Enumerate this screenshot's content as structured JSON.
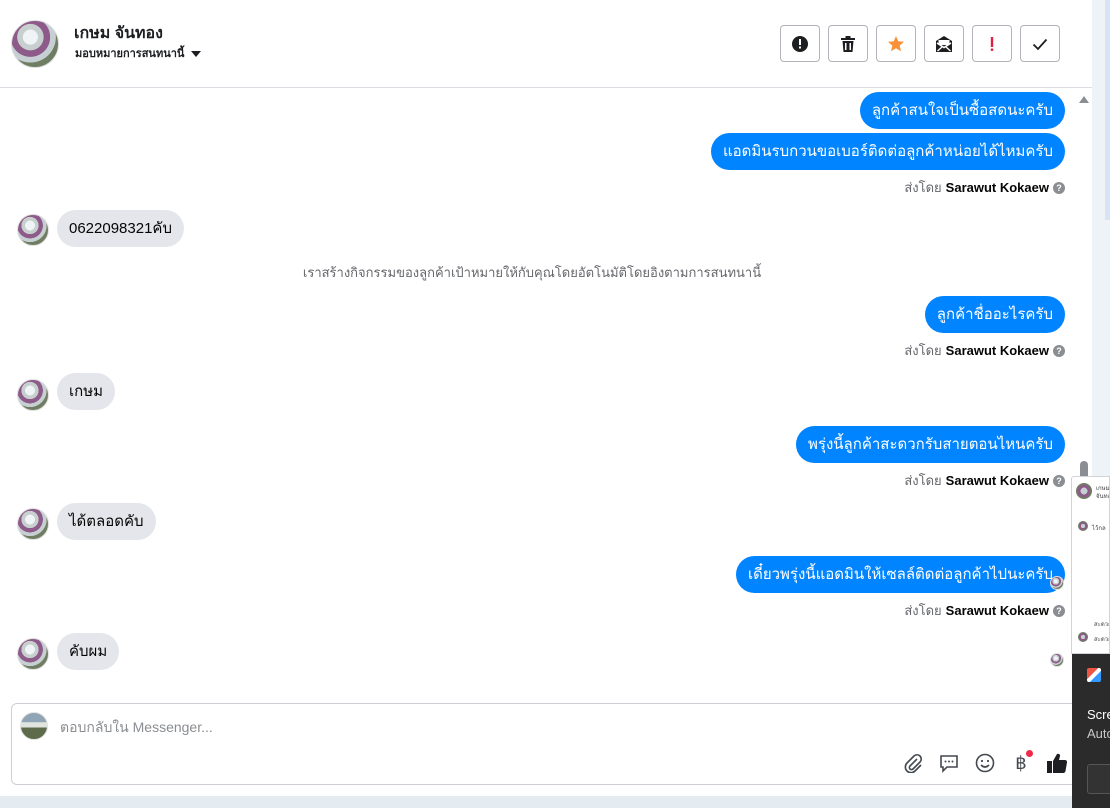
{
  "contact": {
    "name": "เกษม จันทอง",
    "assign_label": "มอบหมายการสนทนานี้"
  },
  "toolbar": {
    "buttons": [
      {
        "icon": "alert-circle-icon",
        "label": "report"
      },
      {
        "icon": "trash-icon",
        "label": "delete"
      },
      {
        "icon": "star-icon",
        "label": "star",
        "color": "#f7923a"
      },
      {
        "icon": "mark-unread-icon",
        "label": "mark unread"
      },
      {
        "icon": "exclamation-icon",
        "label": "spam",
        "color": "#e41e3f"
      },
      {
        "icon": "check-icon",
        "label": "done"
      }
    ]
  },
  "messages": {
    "m1": "ลูกค้าสนใจเป็นซื้อสดนะครับ",
    "m2": "แอดมินรบกวนขอเบอร์ติดต่อลูกค้าหน่อยได้ไหมครับ",
    "m3": "0622098321คับ",
    "m4": "ลูกค้าชื่ออะไรครับ",
    "m5": "เกษม",
    "m6": "พรุ่งนี้ลูกค้าสะดวกรับสายตอนไหนครับ",
    "m7": "ได้ตลอดคับ",
    "m8": "เดี๋ยวพรุ่งนี้แอดมินให้เซลล์ติดต่อลูกค้าไปนะครับ",
    "m9": "คับผม"
  },
  "sent_by": {
    "prefix": "ส่งโดย",
    "name": "Sarawut Kokaew",
    "help": "?"
  },
  "system_note": "เราสร้างกิจกรรมของลูกค้าเป้าหมายให้กับคุณโดยอัตโนมัติโดยอิงตามการสนทนานี้",
  "composer": {
    "placeholder": "ตอบกลับใน Messenger..."
  },
  "colors": {
    "outgoing_bubble": "#0084ff",
    "incoming_bubble": "#e4e6eb",
    "star": "#f7923a",
    "alert": "#e41e3f"
  },
  "overlay": {
    "popup_lines": [
      "เกษม",
      "จันทอง",
      "ไว้กล",
      "สะดวก",
      "สะดวก"
    ],
    "notification_title": "Scre",
    "notification_sub": "Auto"
  }
}
